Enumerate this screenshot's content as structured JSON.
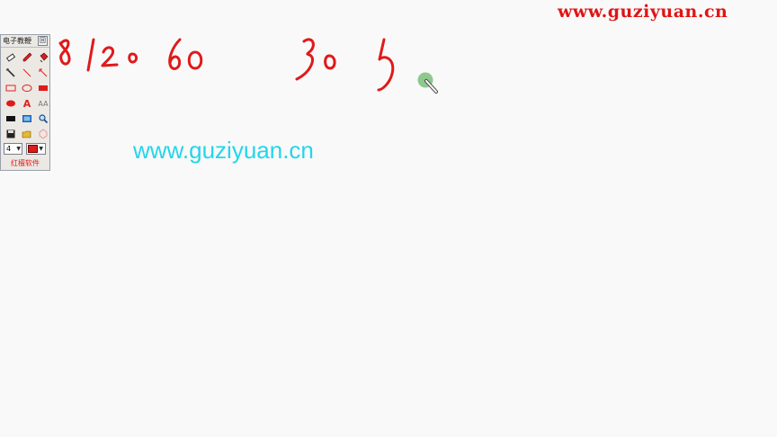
{
  "watermark": {
    "text": "www.guziyuan.cn"
  },
  "center_url": {
    "text": "www.guziyuan.cn"
  },
  "handwriting": {
    "text": "8 120 60 30 5"
  },
  "palette": {
    "title": "电子教鞭",
    "close_label": "回",
    "brand_label": "红檀软件",
    "pen_size": "4",
    "pen_color": "#e01a1a",
    "tools": [
      {
        "name": "eraser-icon"
      },
      {
        "name": "pen-icon"
      },
      {
        "name": "highlighter-icon"
      },
      {
        "name": "pointer-stick-icon"
      },
      {
        "name": "line-icon"
      },
      {
        "name": "arrow-icon"
      },
      {
        "name": "rectangle-outline-icon"
      },
      {
        "name": "ellipse-outline-icon"
      },
      {
        "name": "rectangle-filled-icon"
      },
      {
        "name": "ellipse-filled-icon"
      },
      {
        "name": "text-tool-icon"
      },
      {
        "name": "font-icon"
      },
      {
        "name": "blackboard-icon"
      },
      {
        "name": "screen-capture-icon"
      },
      {
        "name": "zoom-icon"
      },
      {
        "name": "save-icon"
      },
      {
        "name": "open-folder-icon"
      },
      {
        "name": "clear-icon"
      }
    ],
    "tool_text": {
      "text_a": "A",
      "font_aa": "AA"
    }
  }
}
